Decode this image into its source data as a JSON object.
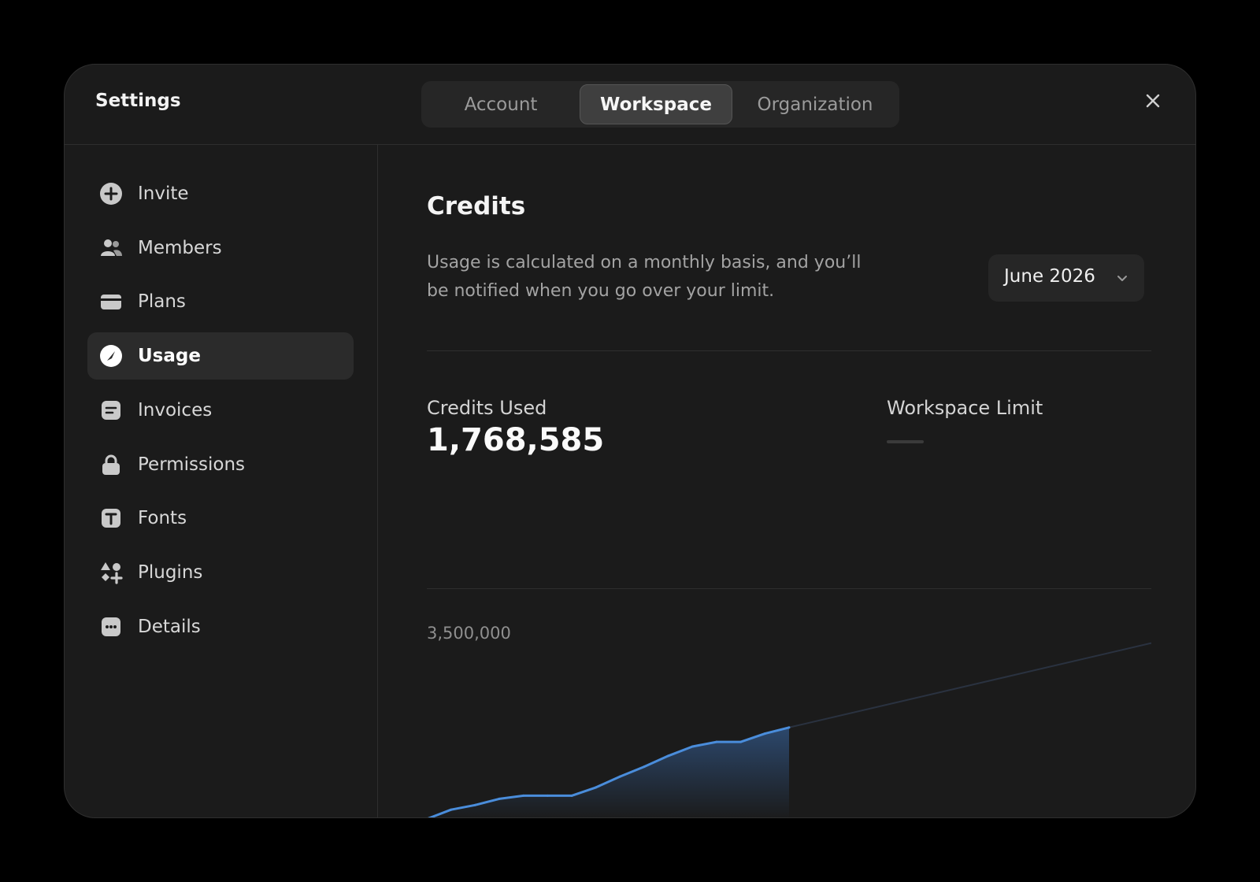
{
  "header": {
    "title": "Settings",
    "tabs": [
      {
        "label": "Account",
        "active": false
      },
      {
        "label": "Workspace",
        "active": true
      },
      {
        "label": "Organization",
        "active": false
      }
    ],
    "close_icon": "close-icon"
  },
  "sidebar": {
    "items": [
      {
        "label": "Invite",
        "icon": "plus-circle-icon"
      },
      {
        "label": "Members",
        "icon": "users-icon"
      },
      {
        "label": "Plans",
        "icon": "card-icon"
      },
      {
        "label": "Usage",
        "icon": "gauge-icon",
        "active": true
      },
      {
        "label": "Invoices",
        "icon": "document-icon"
      },
      {
        "label": "Permissions",
        "icon": "lock-icon"
      },
      {
        "label": "Fonts",
        "icon": "type-icon"
      },
      {
        "label": "Plugins",
        "icon": "shapes-icon"
      },
      {
        "label": "Details",
        "icon": "ellipsis-icon"
      }
    ]
  },
  "main": {
    "heading": "Credits",
    "description": "Usage is calculated on a monthly basis, and you’ll be notified when you go over your limit.",
    "month_select": {
      "value": "June 2026",
      "icon": "chevron-down-icon"
    },
    "credits_used": {
      "label": "Credits Used",
      "value": "1,768,585"
    },
    "workspace_limit": {
      "label": "Workspace Limit",
      "value": "—"
    }
  },
  "colors": {
    "accent": "#4a8ddb",
    "background": "#1b1b1b",
    "page": "#000000"
  },
  "chart_data": {
    "type": "area",
    "y_tick_labels": [
      "3,500,000"
    ],
    "ylim": [
      0,
      3500000
    ],
    "xlim": [
      0,
      30
    ],
    "x": [
      0,
      1,
      2,
      3,
      4,
      5,
      6,
      7,
      8,
      9,
      10,
      11,
      12,
      13,
      14,
      15
    ],
    "values": [
      0,
      180000,
      270000,
      390000,
      450000,
      450000,
      450000,
      610000,
      820000,
      1010000,
      1220000,
      1400000,
      1490000,
      1490000,
      1650000,
      1768585
    ],
    "projection": {
      "x": [
        15,
        30
      ],
      "values": [
        1768585,
        3400000
      ]
    },
    "grid": false,
    "legend": "none"
  }
}
